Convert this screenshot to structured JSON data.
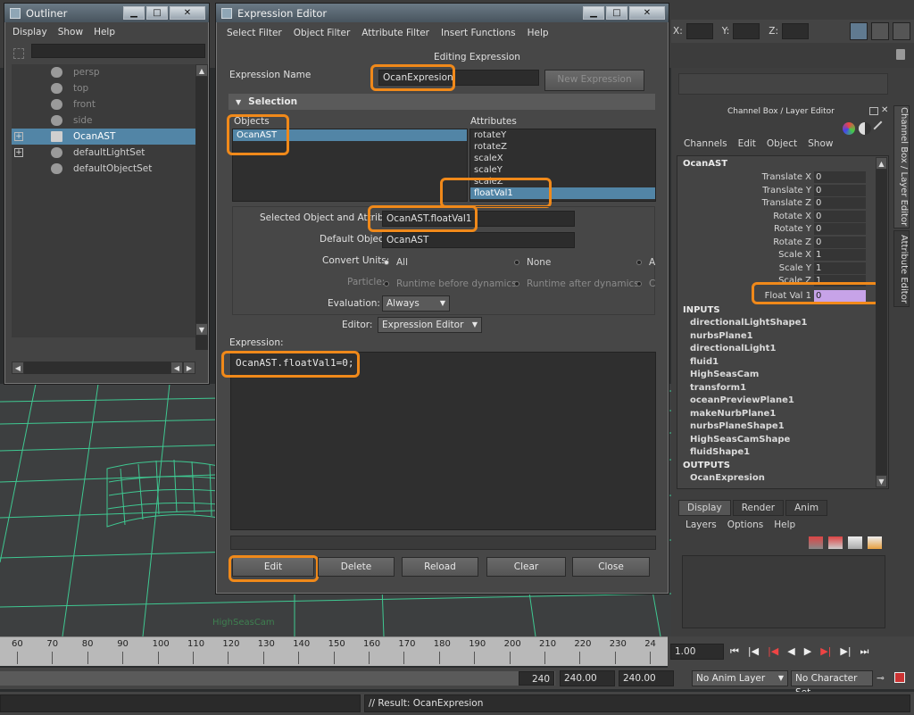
{
  "top_strip": {
    "x_label": "X:",
    "y_label": "Y:",
    "z_label": "Z:"
  },
  "outliner": {
    "title": "Outliner",
    "menu": [
      "Display",
      "Show",
      "Help"
    ],
    "items": [
      {
        "label": "persp",
        "dim": true
      },
      {
        "label": "top",
        "dim": true
      },
      {
        "label": "front",
        "dim": true
      },
      {
        "label": "side",
        "dim": true
      },
      {
        "label": "OcanAST",
        "selected": true
      },
      {
        "label": "defaultLightSet"
      },
      {
        "label": "defaultObjectSet"
      }
    ]
  },
  "expression_editor": {
    "title": "Expression Editor",
    "menu": [
      "Select Filter",
      "Object Filter",
      "Attribute Filter",
      "Insert Functions",
      "Help"
    ],
    "mode_label": "Editing Expression",
    "name_label": "Expression Name",
    "name_value": "OcanExpresion",
    "new_expression_button": "New Expression",
    "selection_header": "Selection",
    "objects_header": "Objects",
    "objects": [
      "OcanAST"
    ],
    "attributes_header": "Attributes",
    "attributes": [
      "rotateY",
      "rotateZ",
      "scaleX",
      "scaleY",
      "scaleZ",
      "floatVal1"
    ],
    "selected_attr_label": "Selected Object and Attribute:",
    "selected_attr_value": "OcanAST.floatVal1",
    "default_object_label": "Default Object:",
    "default_object_value": "OcanAST",
    "convert_units_label": "Convert Units:",
    "convert_units_options": [
      "All",
      "None",
      "A"
    ],
    "particle_label": "Particle:",
    "particle_options": [
      "Runtime before dynamics",
      "Runtime after dynamics",
      "C"
    ],
    "evaluation_label": "Evaluation:",
    "evaluation_value": "Always",
    "editor_label": "Editor:",
    "editor_value": "Expression Editor",
    "expression_label": "Expression:",
    "expression_code": "OcanAST.floatVal1=0;",
    "buttons": {
      "edit": "Edit",
      "delete": "Delete",
      "reload": "Reload",
      "clear": "Clear",
      "close": "Close"
    }
  },
  "channel_box": {
    "title": "Channel Box / Layer Editor",
    "menu": [
      "Channels",
      "Edit",
      "Object",
      "Show"
    ],
    "node": "OcanAST",
    "channels": [
      {
        "name": "Translate X",
        "value": "0"
      },
      {
        "name": "Translate Y",
        "value": "0"
      },
      {
        "name": "Translate Z",
        "value": "0"
      },
      {
        "name": "Rotate X",
        "value": "0"
      },
      {
        "name": "Rotate Y",
        "value": "0"
      },
      {
        "name": "Rotate Z",
        "value": "0"
      },
      {
        "name": "Scale X",
        "value": "1"
      },
      {
        "name": "Scale Y",
        "value": "1"
      },
      {
        "name": "Scale Z",
        "value": "1"
      },
      {
        "name": "Float Val 1",
        "value": "0"
      }
    ],
    "inputs_header": "INPUTS",
    "inputs": [
      "directionalLightShape1",
      "nurbsPlane1",
      "directionalLight1",
      "fluid1",
      "HighSeasCam",
      "transform1",
      "oceanPreviewPlane1",
      "makeNurbPlane1",
      "nurbsPlaneShape1",
      "HighSeasCamShape",
      "fluidShape1"
    ],
    "outputs_header": "OUTPUTS",
    "outputs": [
      "OcanExpresion"
    ],
    "side_tabs": [
      "Channel Box / Layer Editor",
      "Attribute Editor"
    ]
  },
  "layer_editor": {
    "tabs": [
      "Display",
      "Render",
      "Anim"
    ],
    "menu": [
      "Layers",
      "Options",
      "Help"
    ]
  },
  "viewport": {
    "camera_label": "HighSeasCam"
  },
  "timeline": {
    "ticks": [
      "60",
      "70",
      "80",
      "90",
      "100",
      "110",
      "120",
      "130",
      "140",
      "150",
      "160",
      "170",
      "180",
      "190",
      "200",
      "210",
      "220",
      "230",
      "24"
    ],
    "current_frame": "1.00"
  },
  "range_bar": {
    "end_frame": "240",
    "range_start": "240.00",
    "range_end": "240.00",
    "anim_layer": "No Anim Layer",
    "character_set": "No Character Set"
  },
  "command_line": {
    "result": "// Result: OcanExpresion"
  }
}
